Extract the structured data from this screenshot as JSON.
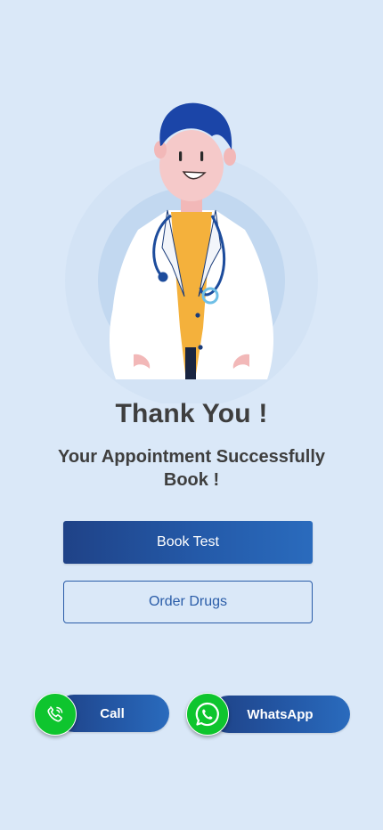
{
  "illustration": {
    "name": "doctor-illustration"
  },
  "heading": {
    "title": "Thank You !",
    "message": "Your Appointment Successfully Book !"
  },
  "actions": {
    "primary_label": "Book Test",
    "secondary_label": "Order Drugs"
  },
  "contact": {
    "call_label": "Call",
    "whatsapp_label": "WhatsApp",
    "call_icon": "phone-icon",
    "whatsapp_icon": "whatsapp-icon",
    "icon_color": "#0ec52e"
  },
  "colors": {
    "background": "#dae8f8",
    "brand": "#245aa9",
    "text": "#3e3e3e"
  }
}
